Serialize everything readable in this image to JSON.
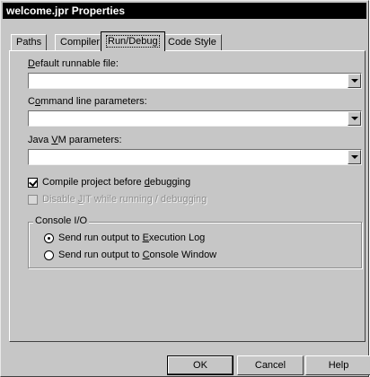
{
  "window": {
    "title": "welcome.jpr Properties"
  },
  "tabs": [
    {
      "label": "Paths"
    },
    {
      "label": "Compiler"
    },
    {
      "label": "Run/Debug",
      "active": true
    },
    {
      "label": "Code Style"
    }
  ],
  "fields": {
    "default_runnable": {
      "label_underline": "D",
      "label_rest": "efault runnable file:",
      "value": ""
    },
    "command_line": {
      "label_pre": "C",
      "label_underline": "o",
      "label_rest": "mmand line parameters:",
      "value": ""
    },
    "java_vm": {
      "label_pre": "Java ",
      "label_underline": "V",
      "label_rest": "M parameters:",
      "value": ""
    }
  },
  "checkboxes": {
    "compile": {
      "label_pre": "Compile project before ",
      "label_underline": "d",
      "label_rest": "ebugging",
      "checked": true,
      "enabled": true
    },
    "disable_jit": {
      "label_pre": "Disable ",
      "label_underline": "J",
      "label_rest": "IT while running / debugging",
      "checked": false,
      "enabled": false
    }
  },
  "console": {
    "group_title": "Console I/O",
    "options": [
      {
        "label_pre": "Send run output to ",
        "label_underline": "E",
        "label_rest": "xecution Log",
        "selected": true
      },
      {
        "label_pre": "Send run output to ",
        "label_underline": "C",
        "label_rest": "onsole Window",
        "selected": false
      }
    ]
  },
  "buttons": {
    "ok": "OK",
    "cancel": "Cancel",
    "help": "Help"
  }
}
